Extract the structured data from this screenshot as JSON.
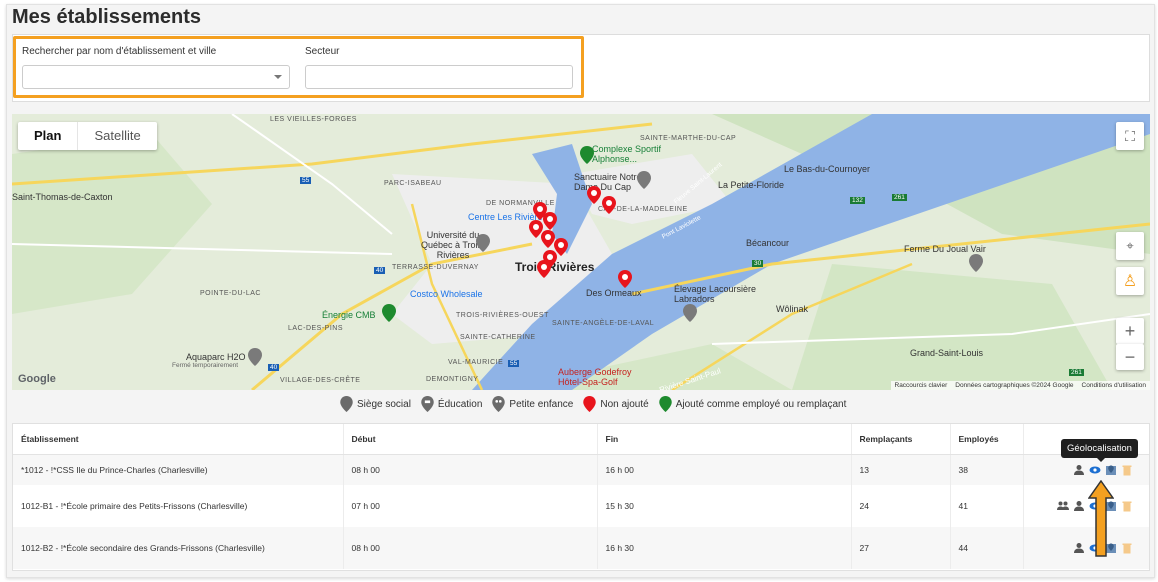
{
  "page": {
    "title": "Mes établissements"
  },
  "filters": {
    "search_label": "Rechercher par nom d'établissement et ville",
    "search_value": "",
    "sector_label": "Secteur",
    "sector_value": ""
  },
  "map": {
    "view_options": [
      "Plan",
      "Satellite"
    ],
    "selected_view": "Plan",
    "labels": {
      "vieilles_forges": "LES VIEILLES-FORGES",
      "sainte_marthe": "SAINTE-MARTHE-DU-CAP",
      "complexe": "Complexe Sportif Alphonse...",
      "sanctuaire": "Sanctuaire Notre-Dame Du Cap",
      "bas_cournoyer": "Le Bas-du-Cournoyer",
      "petite_floride": "La Petite-Floride",
      "thomas_caxton": "Saint-Thomas-de-Caxton",
      "parc_isabeau": "PARC-ISABEAU",
      "normanville": "DE NORMANVILLE",
      "cap_madeleine": "CAP-DE-LA-MADELEINE",
      "centre_rivieres": "Centre Les Rivières",
      "universite": "Université du Québec à Trois-Rivières",
      "terrasse": "TERRASSE-DUVERNAY",
      "trois_rivieres": "Trois-Rivières",
      "becancour": "Bécancour",
      "ferme_joual": "Ferme Du Joual Vair",
      "pointe_du_lac": "POINTE-DU-LAC",
      "costco": "Costco Wholesale",
      "des_ormeaux": "Des Ormeaux",
      "elevage": "Élevage Lacoursière Labradors",
      "wolinak": "Wôlinak",
      "energie": "Énergie CMB",
      "lac_des_pins": "LAC-DES-PINS",
      "tr_ouest": "TROIS-RIVIÈRES-OUEST",
      "sainte_angele": "SAINTE-ANGÈLE-DE-LAVAL",
      "sainte_catherine": "SAINTE-CATHERINE",
      "aquaparc": "Aquaparc H2O",
      "aquaparc_sub": "Fermé temporairement",
      "val_mauricie": "VAL-MAURICIE",
      "auberge": "Auberge Godefroy Hôtel-Spa-Golf",
      "grand_saint_louis": "Grand-Saint-Louis",
      "village_cretes": "VILLAGE-DES-CRÊTE",
      "demontigny": "DEMONTIGNY",
      "fleuve": "Fleuve Saint-Laurent",
      "pont": "Pont Laviolette",
      "riviere": "Rivière Saint-Paul"
    },
    "route_shields": [
      "55",
      "40",
      "132",
      "261",
      "30",
      "55",
      "40",
      "261"
    ],
    "google": "Google",
    "attribution": [
      "Raccourcis clavier",
      "Données cartographiques ©2024 Google",
      "Conditions d'utilisation"
    ]
  },
  "legend": [
    {
      "label": "Siège social",
      "color": "#6b6b6b"
    },
    {
      "label": "Éducation",
      "color": "#6b6b6b"
    },
    {
      "label": "Petite enfance",
      "color": "#6b6b6b"
    },
    {
      "label": "Non ajouté",
      "color": "#e8141c"
    },
    {
      "label": "Ajouté comme employé ou remplaçant",
      "color": "#1e8a2e"
    }
  ],
  "table": {
    "columns": [
      "Établissement",
      "Début",
      "Fin",
      "Remplaçants",
      "Employés",
      ""
    ],
    "rows": [
      {
        "name": "*1012 - !*CSS Ile du Prince-Charles (Charlesville)",
        "start": "08 h 00",
        "end": "16 h 00",
        "replacements": "13",
        "employees": "38"
      },
      {
        "name": "1012-B1 - !*École primaire des Petits-Frissons (Charlesville)",
        "start": "07 h 00",
        "end": "15 h 30",
        "replacements": "24",
        "employees": "41"
      },
      {
        "name": "1012-B2 - !*École secondaire des Grands-Frissons (Charlesville)",
        "start": "08 h 00",
        "end": "16 h 30",
        "replacements": "27",
        "employees": "44"
      }
    ]
  },
  "tooltip": "Géolocalisation",
  "colors": {
    "highlight": "#f4a020",
    "water": "#8fb3e6",
    "land": "#e3ecd9",
    "pin": "#e8141c"
  }
}
